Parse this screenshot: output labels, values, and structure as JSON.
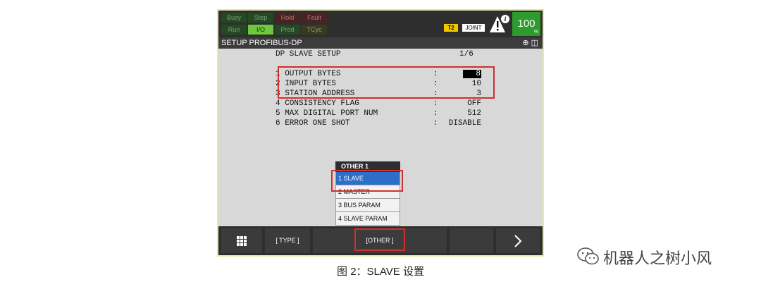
{
  "status": {
    "indicators_row1": [
      "Busy",
      "Step",
      "Hold",
      "Fault"
    ],
    "indicators_row2": [
      "Run",
      "I/O",
      "Prod",
      "TCyc"
    ],
    "badge_t2": "T2",
    "badge_joint": "JOINT",
    "override_value": "100",
    "override_unit": "%",
    "colors": {
      "lit_indicator": "#6ec83c",
      "override_bg": "#2d9b2d",
      "highlight_box": "#d03030",
      "selected_item": "#2b6fc9"
    }
  },
  "title_bar": {
    "title": "SETUP PROFIBUS-DP",
    "icons": [
      "zoom-icon",
      "window-split-icon"
    ]
  },
  "screen": {
    "header": "DP SLAVE SETUP",
    "page": "1/6",
    "rows": [
      {
        "label": "1 OUTPUT BYTES",
        "colon": ":",
        "value": "8"
      },
      {
        "label": "2 INPUT BYTES",
        "colon": ":",
        "value": "10"
      },
      {
        "label": "3 STATION ADDRESS",
        "colon": ":",
        "value": "3"
      },
      {
        "label": "4 CONSISTENCY FLAG",
        "colon": ":",
        "value": "OFF"
      },
      {
        "label": "5 MAX DIGITAL PORT NUM",
        "colon": ":",
        "value": "512"
      },
      {
        "label": "6 ERROR ONE SHOT",
        "colon": ":",
        "value": "DISABLE"
      }
    ]
  },
  "popup": {
    "header": "OTHER    1",
    "items": [
      "1 SLAVE",
      "2 MASTER",
      "3 BUS PARAM",
      "4 SLAVE PARAM"
    ],
    "selected_index": 0
  },
  "fkeys": {
    "type": "[ TYPE ]",
    "other": "[OTHER ]",
    "menu_icon": "grid-menu-icon",
    "next_icon": "chevron-right-icon"
  },
  "caption": "图 2：SLAVE 设置",
  "watermark": "机器人之树小风"
}
